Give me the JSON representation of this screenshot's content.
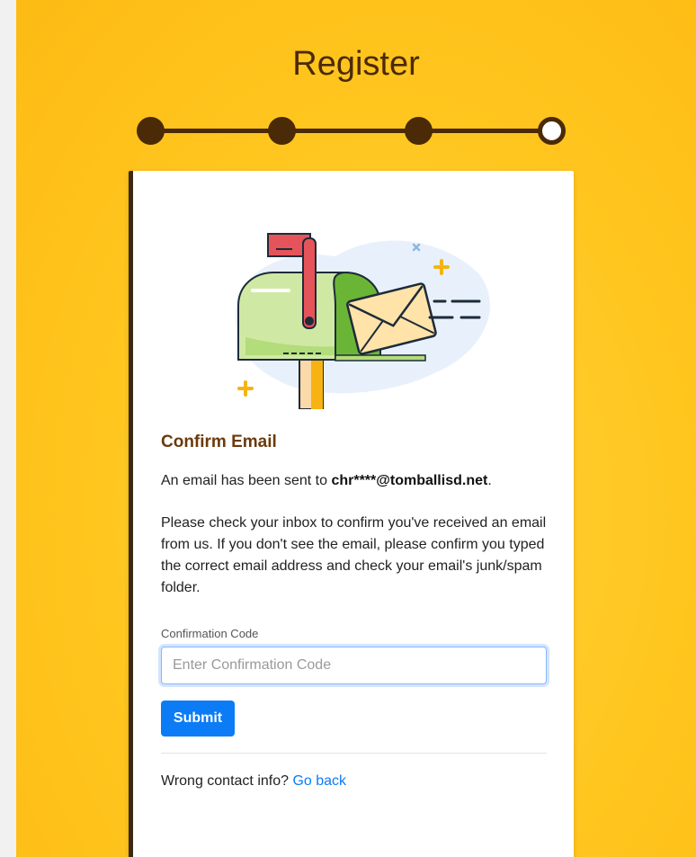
{
  "page": {
    "title": "Register"
  },
  "stepper": {
    "total_steps": 4,
    "current_step": 4
  },
  "card": {
    "heading": "Confirm Email",
    "sent_prefix": "An email has been sent to ",
    "email": "chr****@tomballisd.net",
    "sent_suffix": ".",
    "instructions": "Please check your inbox to confirm you've received an email from us. If you don't see the email, please confirm you typed the correct email address and check your email's junk/spam folder.",
    "field_label": "Confirmation Code",
    "input_value": "",
    "input_placeholder": "Enter Confirmation Code",
    "submit_label": "Submit",
    "wrong_contact_text": "Wrong contact info? ",
    "go_back_label": "Go back"
  },
  "colors": {
    "background": "#fdbb13",
    "brand_brown": "#4a2a07",
    "link_blue": "#0b7cf6"
  },
  "icons": {
    "illustration": "mailbox-with-envelope-icon"
  }
}
